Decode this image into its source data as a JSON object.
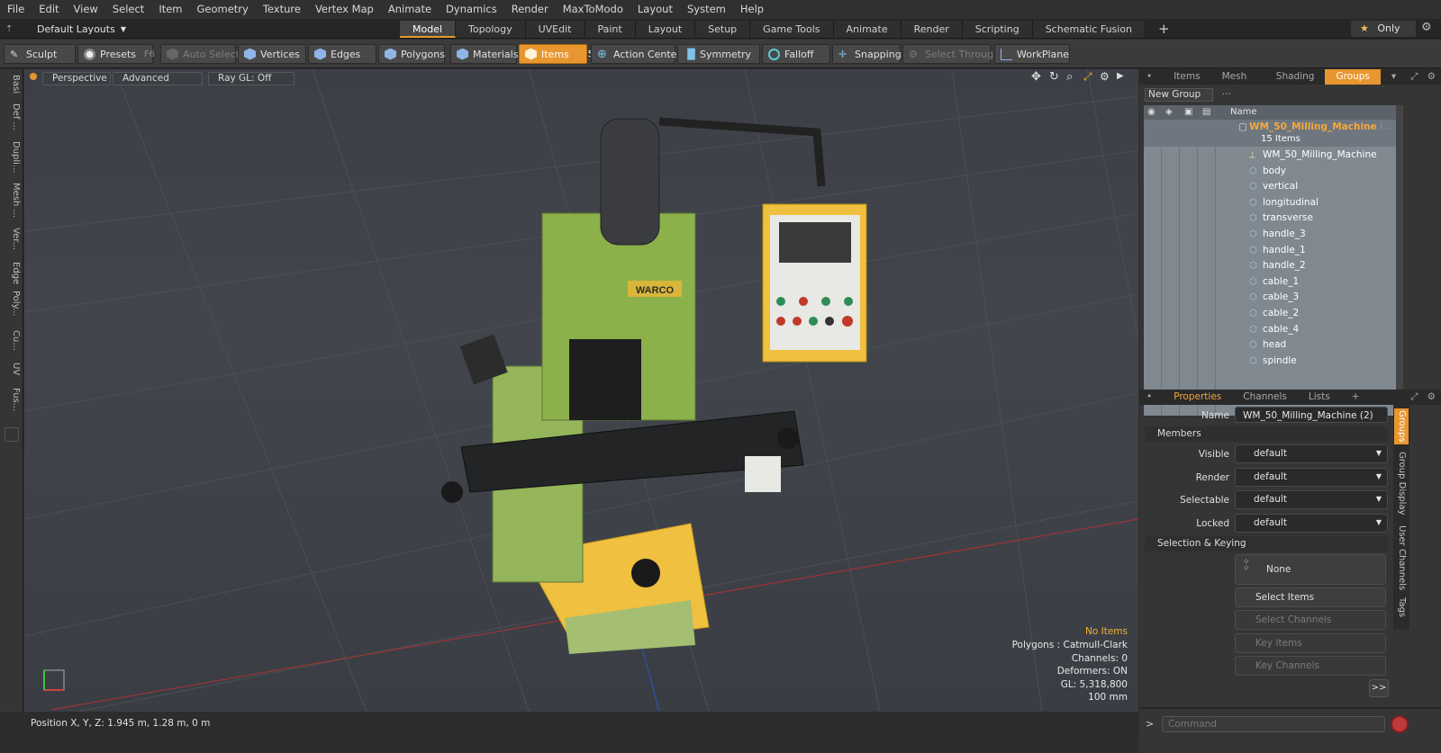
{
  "menu": [
    "File",
    "Edit",
    "View",
    "Select",
    "Item",
    "Geometry",
    "Texture",
    "Vertex Map",
    "Animate",
    "Dynamics",
    "Render",
    "MaxToModo",
    "Layout",
    "System",
    "Help"
  ],
  "layout_bar": {
    "layout": "Default Layouts",
    "tabs": [
      "Model",
      "Topology",
      "UVEdit",
      "Paint",
      "Layout",
      "Setup",
      "Game Tools",
      "Animate",
      "Render",
      "Scripting",
      "Schematic Fusion"
    ],
    "active_tab": "Model",
    "only_label": "Only"
  },
  "toolbar": {
    "sculpt": "Sculpt",
    "presets": "Presets",
    "presets_key": "F6",
    "auto_select": "Auto Select",
    "vertices": "Vertices",
    "vertices_key": "1",
    "edges": "Edges",
    "edges_key": "2",
    "polygons": "Polygons",
    "materials": "Materials",
    "items": "Items",
    "items_key": "5",
    "action_center": "Action Center",
    "symmetry": "Symmetry",
    "falloff": "Falloff",
    "snapping": "Snapping",
    "select_through": "Select Through",
    "workplane": "WorkPlane"
  },
  "left_tabs": [
    "Basi",
    "Def ...",
    "Dupli...",
    "Mesh ...",
    "Ver...",
    "Edge",
    "Poly...",
    "Cu...",
    "UV",
    "Fus..."
  ],
  "viewport": {
    "view": "Perspective",
    "shading": "Advanced",
    "raygl": "Ray GL: Off",
    "info": {
      "items": "No Items",
      "polygons": "Polygons : Catmull-Clark",
      "channels": "Channels: 0",
      "deformers": "Deformers: ON",
      "gl": "GL: 5,318,800",
      "scale": "100 mm"
    },
    "brand_text": "WARCO"
  },
  "status": {
    "position": "Position X, Y, Z:  1.945 m, 1.28 m, 0 m"
  },
  "groups_panel": {
    "tabs": [
      "Items",
      "Mesh ...",
      "Shading",
      "Groups"
    ],
    "active_tab": "Groups",
    "new_group": "New Group",
    "col_name": "Name",
    "group_name": "WM_50_Milling_Machine",
    "group_suffix": "(...",
    "group_count": "15 Items",
    "children": [
      "WM_50_Milling_Machine",
      "body",
      "vertical",
      "longitudinal",
      "transverse",
      "handle_3",
      "handle_1",
      "handle_2",
      "cable_1",
      "cable_3",
      "cable_2",
      "cable_4",
      "head",
      "spindle"
    ]
  },
  "props_panel": {
    "tabs": [
      "Properties",
      "Channels",
      "Lists"
    ],
    "active_tab": "Properties",
    "name_label": "Name",
    "name_value": "WM_50_Milling_Machine (2)",
    "members": "Members",
    "visible_label": "Visible",
    "visible": "default",
    "render_label": "Render",
    "render": "default",
    "selectable_label": "Selectable",
    "selectable": "default",
    "locked_label": "Locked",
    "locked": "default",
    "selection_keying": "Selection & Keying",
    "none": "None",
    "select_items": "Select Items",
    "select_channels": "Select Channels",
    "key_items": "Key Items",
    "key_channels": "Key Channels",
    "more": ">>",
    "side_tabs": [
      "Groups",
      "Group Display",
      "User Channels",
      "Tags"
    ]
  },
  "command": {
    "placeholder": "Command"
  },
  "colors": {
    "accent": "#e8962f",
    "machine_green": "#8cb04a",
    "guard_yellow": "#f0c040"
  }
}
